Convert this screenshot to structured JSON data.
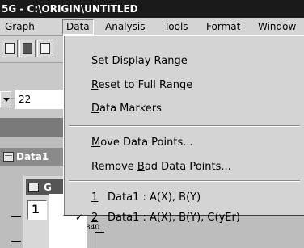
{
  "title_bar": {
    "text": "5G - C:\\ORIGIN\\UNTITLED"
  },
  "menubar": {
    "items": [
      "Graph",
      "Data",
      "Analysis",
      "Tools",
      "Format",
      "Window"
    ],
    "active": "Data"
  },
  "toolbar": {
    "font_size_value": "22",
    "buttons": [
      "new-document-icon",
      "save-document-icon",
      "open-document-icon"
    ]
  },
  "windows": {
    "worksheet_title": "Data1",
    "graph_title_partial": "G",
    "layer_number": "1",
    "axis_value": "340"
  },
  "data_menu": {
    "items": [
      {
        "mnemonic": "S",
        "rest": "et Display Range"
      },
      {
        "mnemonic": "R",
        "rest": "eset to Full Range"
      },
      {
        "mnemonic": "D",
        "rest": "ata Markers"
      },
      {
        "mnemonic": "M",
        "rest": "ove Data Points..."
      },
      {
        "pre": "Remove ",
        "mnemonic": "B",
        "rest": "ad Data Points..."
      }
    ],
    "datasets": [
      {
        "index": "1",
        "label": "Data1 : A(X), B(Y)",
        "checked": false
      },
      {
        "index": "2",
        "label": "Data1 : A(X), B(Y), C(yEr)",
        "checked": true
      }
    ],
    "check_glyph": "✓"
  },
  "colors": {
    "title_bar_bg": "#1a1a1a",
    "menu_bg": "#d4d4d4"
  }
}
